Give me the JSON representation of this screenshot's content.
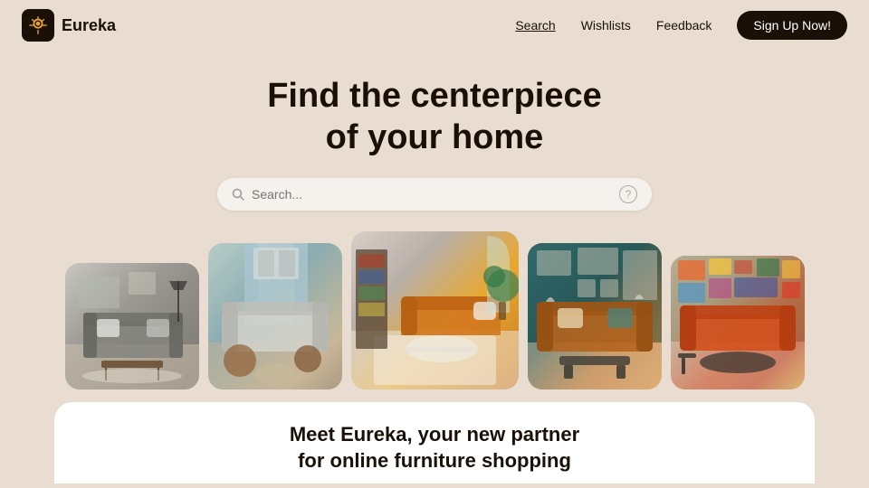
{
  "brand": {
    "name": "Eureka"
  },
  "nav": {
    "links": [
      {
        "label": "Search",
        "active": true
      },
      {
        "label": "Wishlists",
        "active": false
      },
      {
        "label": "Feedback",
        "active": false
      }
    ],
    "signup_label": "Sign Up Now!"
  },
  "hero": {
    "title_line1": "Find the centerpiece",
    "title_line2": "of your home",
    "search_placeholder": "Search..."
  },
  "gallery": {
    "images": [
      {
        "alt": "Living room with grey sofa and wooden coffee table",
        "class": "gi-1",
        "room": "room-1"
      },
      {
        "alt": "Bright room with wooden side tables",
        "class": "gi-2",
        "room": "room-2"
      },
      {
        "alt": "Modern living room with orange sofa",
        "class": "gi-3",
        "room": "room-3"
      },
      {
        "alt": "Teal wall room with leather sofas",
        "class": "gi-4",
        "room": "room-4"
      },
      {
        "alt": "Colorful art gallery room with orange sofa",
        "class": "gi-5",
        "room": "room-5"
      }
    ]
  },
  "bottom_card": {
    "title_line1": "Meet Eureka, your new partner",
    "title_line2": "for online furniture shopping"
  }
}
